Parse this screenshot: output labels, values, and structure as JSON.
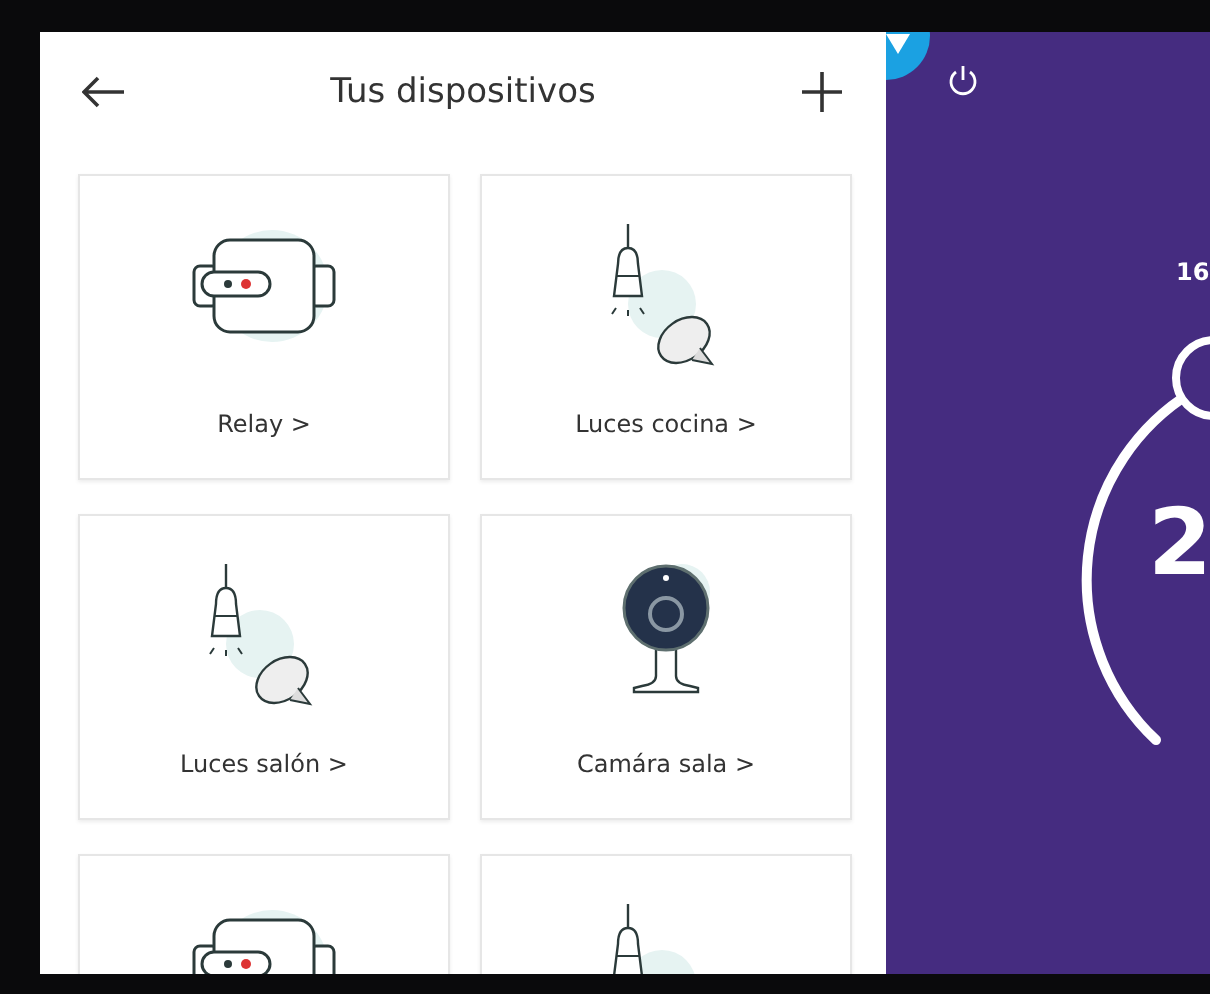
{
  "header": {
    "title": "Tus dispositivos"
  },
  "devices": [
    {
      "kind": "relay",
      "label": "Relay >"
    },
    {
      "kind": "lights",
      "label": "Luces cocina >"
    },
    {
      "kind": "lights",
      "label": "Luces salón >"
    },
    {
      "kind": "camera",
      "label": "Camára sala >"
    },
    {
      "kind": "relay"
    },
    {
      "kind": "lights"
    }
  ],
  "thermostat": {
    "setpoint": "16",
    "temperature": "2"
  }
}
